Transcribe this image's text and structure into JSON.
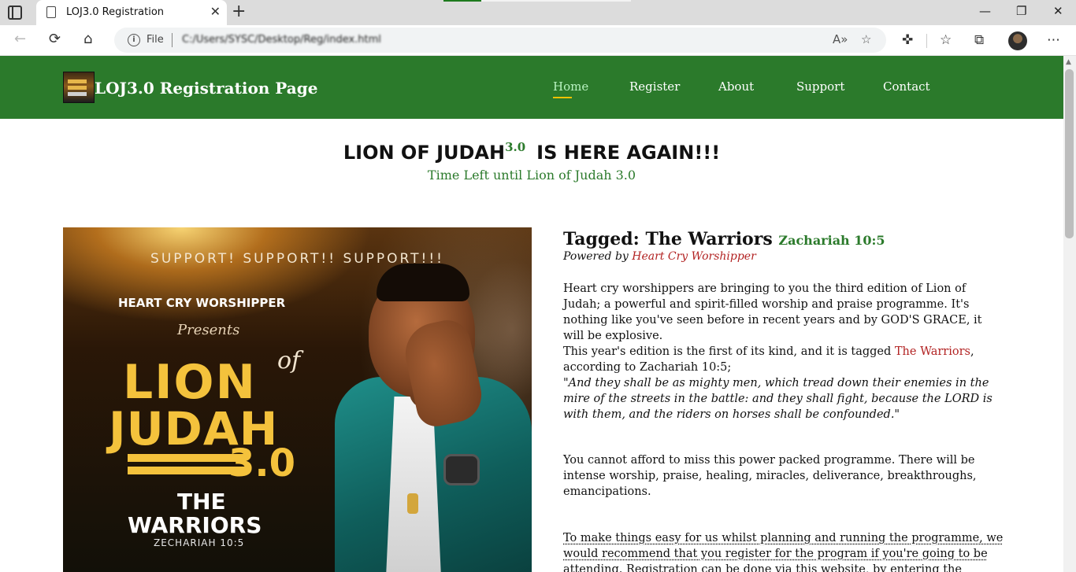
{
  "browser": {
    "tab_title": "LOJ3.0 Registration",
    "tab_close": "✕",
    "new_tab": "+",
    "address_file_label": "File",
    "address_url": "C:/Users/SYSC/Desktop/Reg/index.html",
    "minimize": "—",
    "maximize": "❐",
    "close": "✕"
  },
  "site": {
    "logo_alt": "LOJ3.0 poster thumbnail",
    "title": "LOJ3.0 Registration Page",
    "menu": [
      {
        "label": "Home",
        "active": true
      },
      {
        "label": "Register",
        "active": false
      },
      {
        "label": "About",
        "active": false
      },
      {
        "label": "Support",
        "active": false
      },
      {
        "label": "Contact",
        "active": false
      }
    ]
  },
  "hero": {
    "headline_main": "LION OF JUDAH",
    "headline_sup": "3.0",
    "headline_tail": "IS HERE AGAIN!!!",
    "subtitle": "Time Left until Lion of Judah 3.0"
  },
  "poster": {
    "support": "SUPPORT! SUPPORT!! SUPPORT!!!",
    "organizer": "HEART CRY WORSHIPPER",
    "presents": "Presents",
    "lion": "LION",
    "of": "of",
    "judah": "JUDAH",
    "version": "3.0",
    "the": "THE",
    "warriors": "WARRIORS",
    "scripture": "ZECHARIAH 10:5"
  },
  "article": {
    "title": "Tagged: The Warriors",
    "title_ref": "Zachariah 10:5",
    "powered_prefix": "Powered by",
    "powered_by": "Heart Cry Worshipper",
    "p1": "Heart cry worshippers are bringing to you the third edition of Lion of Judah; a powerful and spirit-filled worship and praise programme. It's nothing like you've seen before in recent years and by GOD'S GRACE, it will be explosive.",
    "p2_before": "This year's edition is the first of its kind, and it is tagged",
    "p2_tag": "The Warriors",
    "p2_after": ", according to Zachariah 10:5;",
    "p2_quote": "\"And they shall be as mighty men, which tread down their enemies in the mire of the streets in the battle: and they shall fight, because the LORD is with them, and the riders on horses shall be confounded.\"",
    "p3": "You cannot afford to miss this power packed programme. There will be intense worship, praise, healing, miracles, deliverance, breakthroughs, emancipations.",
    "p4": "To make things easy for us whilst planning and running the programme, we would recommend that you register for the program if you're going to be attending. Registration can be done via this website, by entering the registration"
  },
  "icons": {
    "tab_actions": "tab-actions-icon",
    "back": "←",
    "refresh": "⟳",
    "home": "⌂",
    "read_aloud": "A»",
    "add_favorite": "☆",
    "extensions": "✜",
    "favorites": "☆",
    "collections": "⧉",
    "more": "⋯"
  },
  "colors": {
    "header_green": "#2b7a2b",
    "accent_green": "#2b7a2b",
    "link_red": "#b22222",
    "active_underline": "#f2c200"
  }
}
